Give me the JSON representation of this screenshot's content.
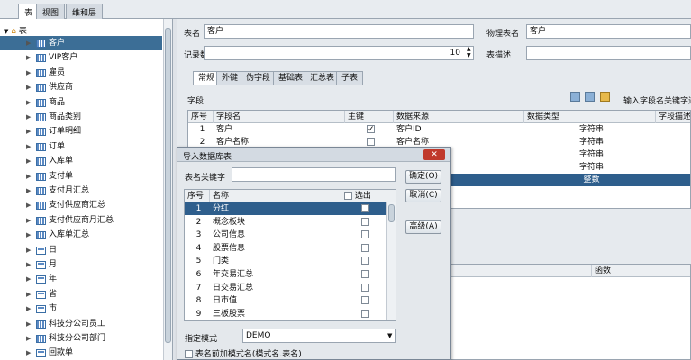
{
  "top_tabs": [
    "表",
    "视图",
    "维和层"
  ],
  "tree": {
    "root": "表",
    "items": [
      "客户",
      "VIP客户",
      "雇员",
      "供应商",
      "商品",
      "商品类别",
      "订单明细",
      "订单",
      "入库单",
      "支付单",
      "支付月汇总",
      "支付供应商汇总",
      "支付供应商月汇总",
      "入库单汇总",
      "日",
      "月",
      "年",
      "省",
      "市",
      "科技分公司员工",
      "科技分公司部门",
      "回款单"
    ]
  },
  "form": {
    "table_name_label": "表名",
    "table_name_value": "客户",
    "physical_name_label": "物理表名",
    "physical_name_value": "客户",
    "record_count_label": "记录数",
    "record_count_value": "10",
    "table_desc_label": "表描述",
    "table_desc_value": ""
  },
  "sub_tabs": [
    "常规",
    "外键",
    "伪字段",
    "基础表",
    "汇总表",
    "子表"
  ],
  "fields_label": "字段",
  "search_placeholder": "输入字段名关键字进行",
  "fields_table": {
    "headers": [
      "序号",
      "字段名",
      "主键",
      "数据来源",
      "数据类型",
      "字段描述"
    ],
    "rows": [
      {
        "no": "1",
        "name": "客户",
        "pk": true,
        "source": "客户ID",
        "type": "字符串"
      },
      {
        "no": "2",
        "name": "客户名称",
        "pk": false,
        "source": "客户名称",
        "type": "字符串"
      },
      {
        "no": "",
        "name": "",
        "pk": false,
        "source": "",
        "type": "字符串"
      },
      {
        "no": "",
        "name": "",
        "pk": false,
        "source": "",
        "type": "字符串"
      },
      {
        "no": "",
        "name": "",
        "pk": false,
        "source": "",
        "type": "整数"
      }
    ]
  },
  "lower_table": {
    "header": "函数"
  },
  "dialog": {
    "title": "导入数据库表",
    "keyword_label": "表名关键字",
    "keyword_value": "",
    "ok": "确定(O)",
    "cancel": "取消(C)",
    "advanced": "高级(A)",
    "headers": [
      "序号",
      "名称",
      "选出"
    ],
    "rows": [
      {
        "no": "1",
        "name": "分红"
      },
      {
        "no": "2",
        "name": "概念板块"
      },
      {
        "no": "3",
        "name": "公司信息"
      },
      {
        "no": "4",
        "name": "股票信息"
      },
      {
        "no": "5",
        "name": "门类"
      },
      {
        "no": "6",
        "name": "年交易汇总"
      },
      {
        "no": "7",
        "name": "日交易汇总"
      },
      {
        "no": "8",
        "name": "日市值"
      },
      {
        "no": "9",
        "name": "三板股票"
      }
    ],
    "schema_label": "指定模式",
    "schema_value": "DEMO",
    "prefix_label": "表名前加模式名(模式名.表名)"
  }
}
